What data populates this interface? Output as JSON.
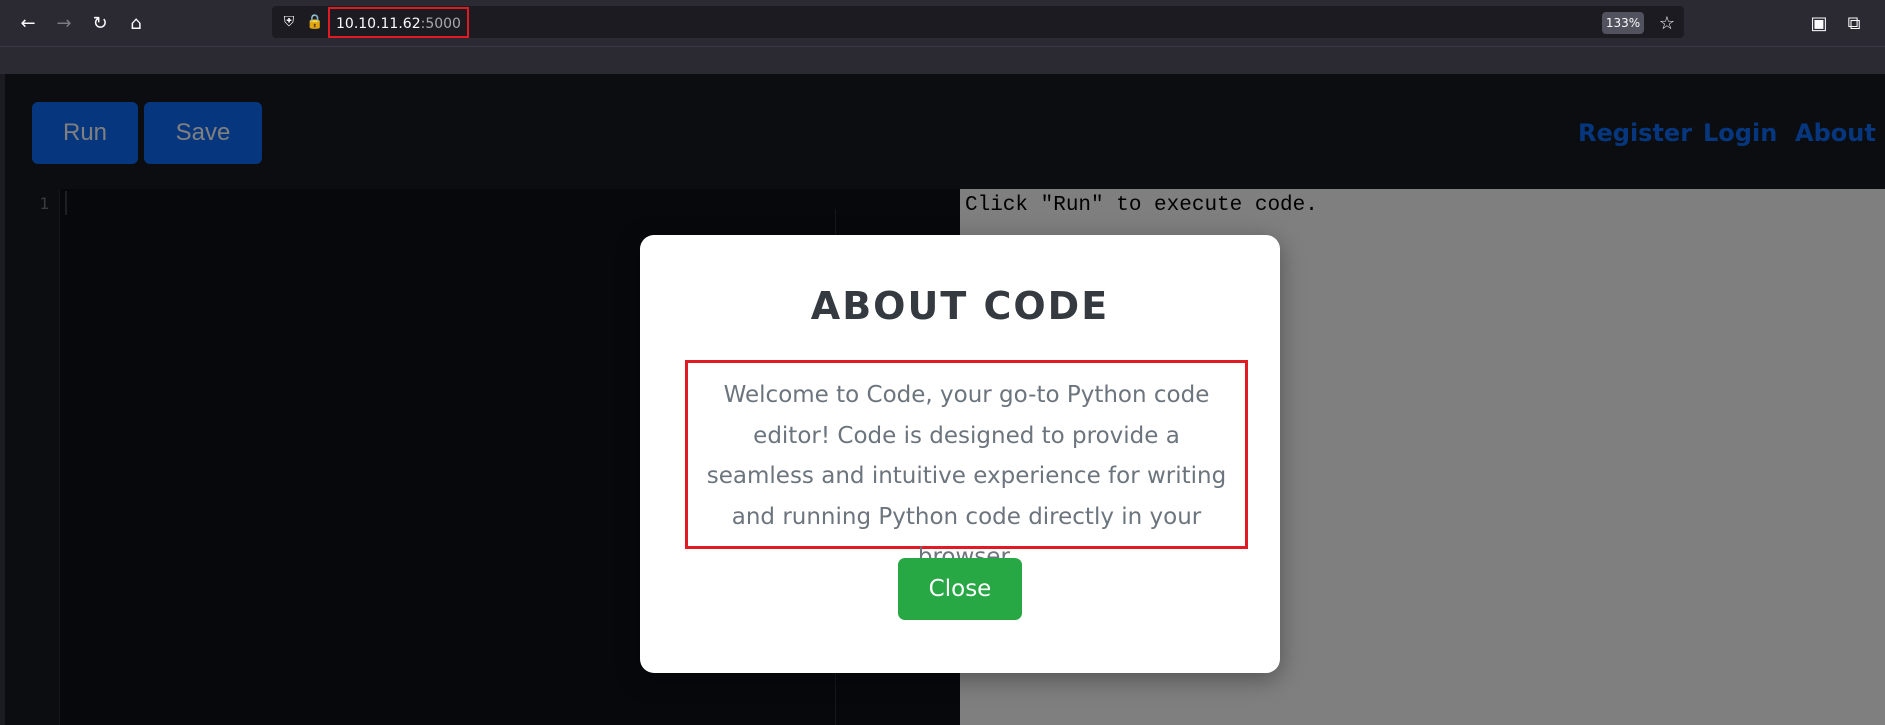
{
  "browser": {
    "url_host": "10.10.11.62",
    "url_port": ":5000",
    "zoom": "133%",
    "icons": [
      "back-arrow-icon",
      "forward-arrow-icon",
      "reload-icon",
      "home-icon",
      "shield-icon",
      "lock-icon",
      "star-icon",
      "pocket-icon",
      "extensions-icon"
    ]
  },
  "app": {
    "run_label": "Run",
    "save_label": "Save",
    "nav": {
      "register": "Register",
      "login": "Login",
      "about": "About"
    },
    "editor": {
      "line_numbers": [
        "1"
      ]
    },
    "output": {
      "text": "Click \"Run\" to execute code."
    }
  },
  "modal": {
    "title": "ABOUT CODE",
    "body": "Welcome to Code, your go-to Python code editor! Code is designed to provide a seamless and intuitive experience for writing and running Python code directly in your browser.",
    "close_label": "Close"
  },
  "colors": {
    "primary": "#0d6efd",
    "success": "#28a745",
    "highlight": "#e01b24"
  }
}
